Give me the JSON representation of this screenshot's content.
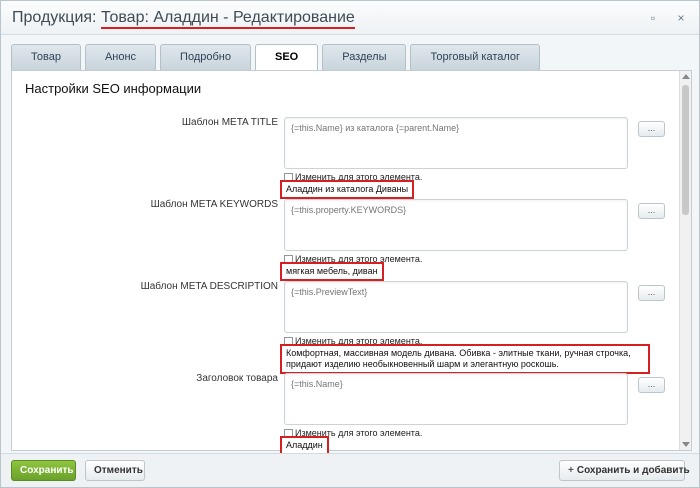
{
  "window": {
    "title_part_a": "Продукция: ",
    "title_part_b": "Товар: Аладдин - Редактирование",
    "buttons": {
      "expand_icon": "expand-icon",
      "close_icon": "close-icon",
      "expand_glyph": "▫",
      "close_glyph": "×"
    }
  },
  "tabs": [
    {
      "label": "Товар",
      "active": false
    },
    {
      "label": "Анонс",
      "active": false
    },
    {
      "label": "Подробно",
      "active": false
    },
    {
      "label": "SEO",
      "active": true
    },
    {
      "label": "Разделы",
      "active": false
    },
    {
      "label": "Торговый каталог",
      "active": false
    }
  ],
  "panel": {
    "title": "Настройки SEO информации"
  },
  "fields": [
    {
      "label": "Шаблон META TITLE",
      "template": "{=this.Name} из каталога {=parent.Name}",
      "button": "...",
      "checkbox_label": "Изменить для этого элемента.",
      "result": "Аладдин из каталога Диваны"
    },
    {
      "label": "Шаблон META KEYWORDS",
      "template": "{=this.property.KEYWORDS}",
      "button": "...",
      "checkbox_label": "Изменить для этого элемента.",
      "result": "мягкая мебель, диван"
    },
    {
      "label": "Шаблон META DESCRIPTION",
      "template": "{=this.PreviewText}",
      "button": "...",
      "checkbox_label": "Изменить для этого элемента.",
      "result": "Комфортная, массивная модель дивана. Обивка - элитные ткани, ручная строчка, придают изделию необыкновенный шарм и элегантную роскошь."
    },
    {
      "label": "Заголовок товара",
      "template": "{=this.Name}",
      "button": "...",
      "checkbox_label": "Изменить для этого элемента.",
      "result": "Аладдин"
    }
  ],
  "footer": {
    "save_label": "Сохранить",
    "cancel_label": "Отменить",
    "save_add_label": "Сохранить и добавить",
    "plus_glyph": "+"
  },
  "colors": {
    "accent_green": "#6aa12a",
    "highlight_red": "#d42020"
  }
}
